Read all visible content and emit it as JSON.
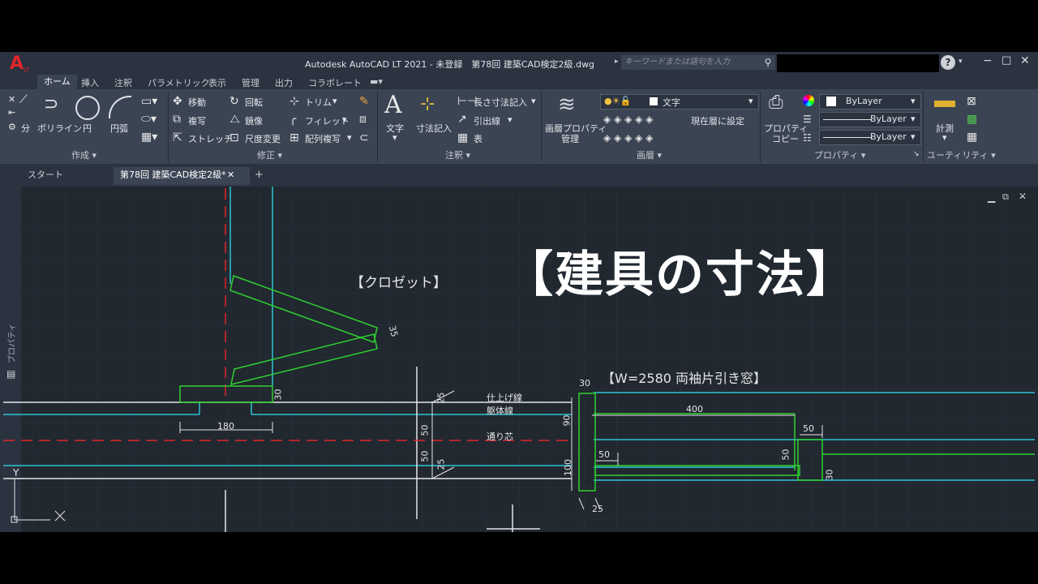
{
  "title": "Autodesk AutoCAD LT 2021 - 未登録　第78回 建築CAD検定2級.dwg",
  "logo": {
    "letter": "A",
    "sub": "LT"
  },
  "search_placeholder": "キーワードまたは語句を入力",
  "ribbon_tabs": [
    "ホーム",
    "挿入",
    "注釈",
    "パラメトリック",
    "表示",
    "管理",
    "出力",
    "コラボレート"
  ],
  "draw": {
    "cut": "分",
    "polyline": "ポリライン",
    "circle": "円",
    "arc": "円弧",
    "title": "作成 ▾"
  },
  "modify": {
    "move": "移動",
    "rotate": "回転",
    "trim": "トリム",
    "copy": "複写",
    "mirror": "鏡像",
    "fillet": "フィレット",
    "stretch": "ストレッチ",
    "scale": "尺度変更",
    "array": "配列複写",
    "title": "修正 ▾"
  },
  "annotation": {
    "text": "文字",
    "dim": "寸法記入",
    "linear": "長さ寸法記入",
    "leader": "引出線",
    "table": "表",
    "title": "注釈 ▾"
  },
  "layers": {
    "props": "画層プロパティ",
    "manage": "管理",
    "current_layer": "文字",
    "set_current": "現在層に設定",
    "title": "画層 ▾"
  },
  "properties": {
    "copy1": "プロパティ",
    "copy2": "コピー",
    "bylayer": "ByLayer",
    "title": "プロパティ ▾"
  },
  "utilities": {
    "measure": "計測",
    "title": "ユーティリティ ▾"
  },
  "file_tabs": {
    "start": "スタート",
    "doc": "第78回 建築CAD検定2級*",
    "add": "+"
  },
  "side_palette": "プロパティ",
  "drawing": {
    "heading": "【建具の寸法】",
    "closet": "【クロゼット】",
    "window": "【W=2580 両袖片引き窓】",
    "finish": "仕上げ線",
    "body": "躯体線",
    "center": "通り芯",
    "dims": {
      "d35": "35",
      "d30a": "30",
      "d180": "180",
      "d25a": "25",
      "d50a": "50",
      "d50b": "50",
      "d25b": "25",
      "d30b": "30",
      "d90": "90",
      "d100": "100",
      "d400": "400",
      "d50c": "50",
      "d50d": "50",
      "d50e": "50",
      "d30c": "30",
      "d25c": "25"
    }
  },
  "colors": {
    "bg": "#212830",
    "cyan": "#2ec4d6",
    "green": "#2fd12f",
    "red": "#e0262a",
    "white": "#e6e6e6"
  }
}
